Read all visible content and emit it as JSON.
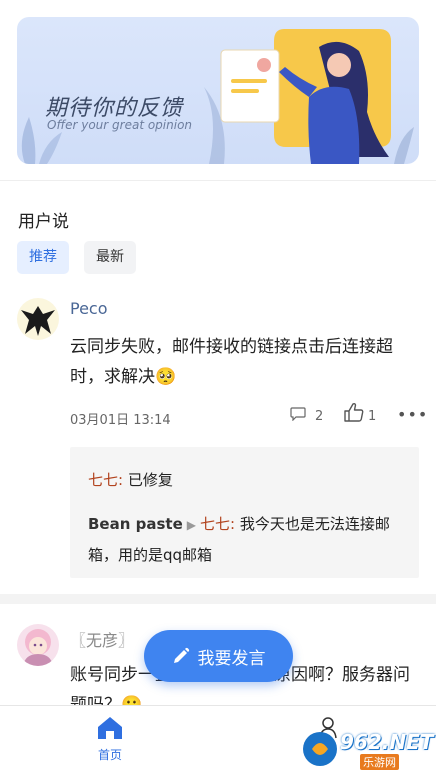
{
  "banner": {
    "title": "期待你的反馈",
    "subtitle": "Offer your great opinion"
  },
  "section": {
    "title": "用户说"
  },
  "tabs": [
    {
      "label": "推荐",
      "active": true
    },
    {
      "label": "最新",
      "active": false
    }
  ],
  "posts": [
    {
      "username": "Peco",
      "text": "云同步失败，邮件接收的链接点击后连接超时，求解决🥺",
      "date": "03月01日 13:14",
      "comments": "2",
      "likes": "1",
      "replies": {
        "first_name": "七七:",
        "first_text": "已修复",
        "second_author": "Bean paste",
        "second_target": "七七:",
        "second_text": "我今天也是无法连接邮箱，用的是qq邮箱"
      }
    },
    {
      "username": "〖无彦〗",
      "text": "账号同步一直失败，是什么原因啊？服务器问题吗？🙂"
    }
  ],
  "fab": {
    "label": "我要发言"
  },
  "nav": {
    "home_label": "首页"
  },
  "watermark": {
    "brand": "962.NET",
    "sub": "乐游网"
  },
  "colors": {
    "accent": "#3f84f0",
    "reply_name": "#b2431e",
    "username": "#4a6796"
  }
}
